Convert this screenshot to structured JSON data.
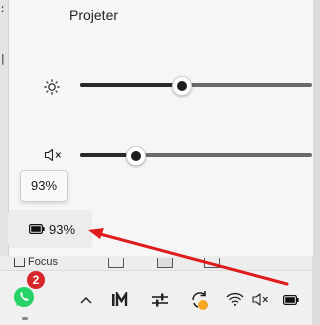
{
  "flyout": {
    "cast_label": "Projeter",
    "brightness_level": 0.44,
    "volume_level": 0.24,
    "battery_tooltip": "93%",
    "battery_label": "93%"
  },
  "app_toolbar": {
    "focus_label": "Focus"
  },
  "taskbar": {
    "whatsapp_badge": "2"
  },
  "annotation": {
    "arrow_color": "#e01b1b"
  }
}
